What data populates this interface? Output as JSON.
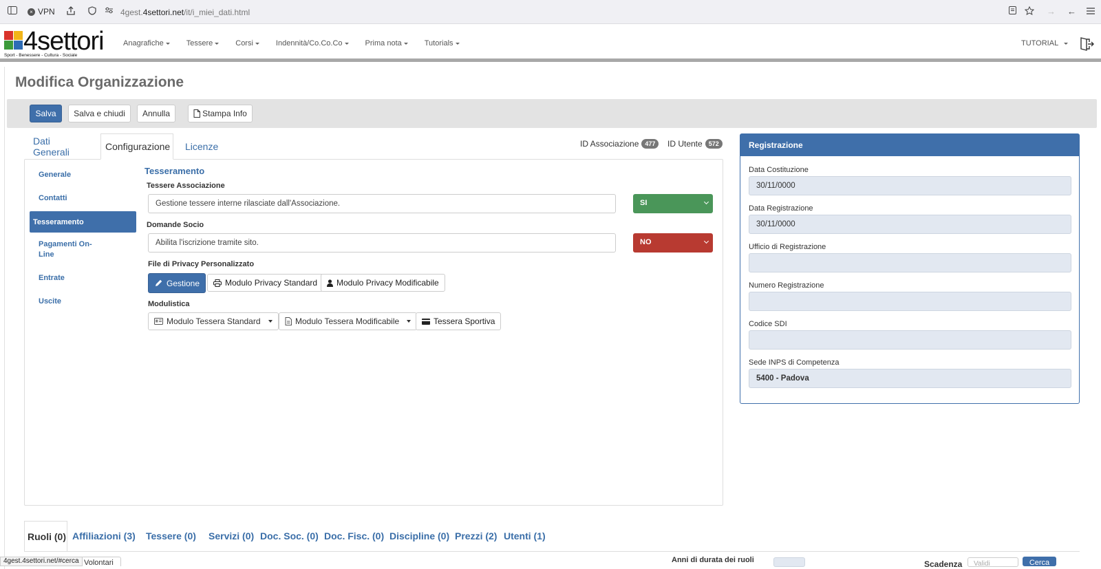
{
  "browser": {
    "vpn_label": "VPN",
    "url_host": "4gest.",
    "url_domain": "4settori.net",
    "url_path": "/it/i_miei_dati.html"
  },
  "header": {
    "logo_text": "4settori",
    "logo_tagline": "Sport - Benessere - Cultura - Sociale",
    "nav": [
      "Anagrafiche",
      "Tessere",
      "Corsi",
      "Indennità/Co.Co.Co",
      "Prima nota",
      "Tutorials"
    ],
    "user_menu": "TUTORIAL"
  },
  "page": {
    "title": "Modifica Organizzazione"
  },
  "toolbar": {
    "save": "Salva",
    "save_close": "Salva e chiudi",
    "cancel": "Annulla",
    "print_info": "Stampa Info"
  },
  "tabs": [
    "Dati Generali",
    "Configurazione",
    "Licenze"
  ],
  "ids": {
    "assoc_label": "ID Associazione",
    "assoc_value": "477",
    "user_label": "ID Utente",
    "user_value": "572"
  },
  "sidenav": [
    "Generale",
    "Contatti",
    "Tesseramento",
    "Pagamenti On-Line",
    "Entrate",
    "Uscite"
  ],
  "tesseramento": {
    "section_title": "Tesseramento",
    "tessere_label": "Tessere Associazione",
    "tessere_desc": "Gestione tessere interne rilasciate dall'Associazione.",
    "tessere_value": "SI",
    "domande_label": "Domande Socio",
    "domande_desc": "Abilita l'iscrizione tramite sito.",
    "domande_value": "NO",
    "privacy_label": "File di Privacy Personalizzato",
    "btn_gestione": "Gestione",
    "btn_privacy_std": "Modulo Privacy Standard",
    "btn_privacy_mod": "Modulo Privacy Modificabile",
    "modulistica_label": "Modulistica",
    "btn_tessera_std": "Modulo Tessera Standard",
    "btn_tessera_mod": "Modulo Tessera Modificabile",
    "btn_tessera_sport": "Tessera Sportiva"
  },
  "registrazione": {
    "title": "Registrazione",
    "fields": [
      {
        "label": "Data Costituzione",
        "value": "30/11/0000"
      },
      {
        "label": "Data Registrazione",
        "value": "30/11/0000"
      },
      {
        "label": "Ufficio di Registrazione",
        "value": ""
      },
      {
        "label": "Numero Registrazione",
        "value": ""
      },
      {
        "label": "Codice SDI",
        "value": ""
      },
      {
        "label": "Sede INPS di Competenza",
        "value": "5400 - Padova"
      }
    ]
  },
  "bottom_tabs": [
    "Ruoli (0)",
    "Affiliazioni (3)",
    "Tessere (0)",
    "Servizi (0)",
    "Doc. Soc. (0)",
    "Doc. Fisc. (0)",
    "Discipline (0)",
    "Prezzi (2)",
    "Utenti (1)"
  ],
  "bottom": {
    "volontari": "Volontari",
    "anni_label": "Anni di durata dei ruoli",
    "scadenza_label": "Scadenza",
    "scadenza_placeholder": "Validi",
    "cerca": "Cerca"
  },
  "status_url": "4gest.4settori.net/#cerca"
}
